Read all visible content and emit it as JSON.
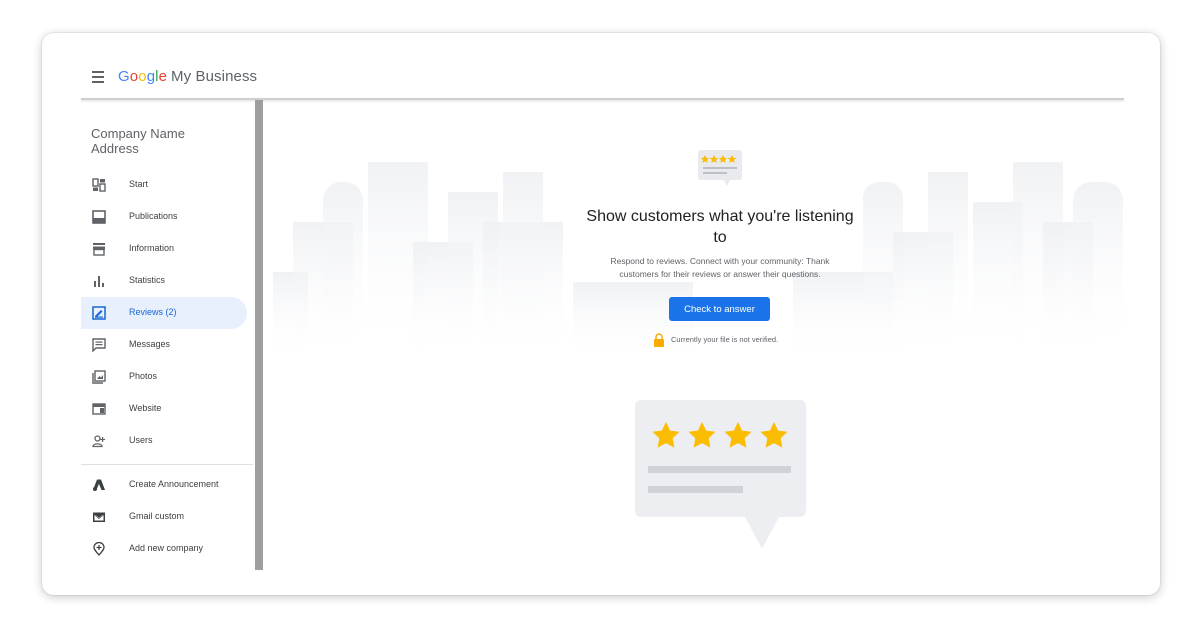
{
  "header": {
    "logo_letters": [
      "G",
      "o",
      "o",
      "g",
      "l",
      "e"
    ],
    "logo_rest": "My Business"
  },
  "sidebar": {
    "company_name": "Company Name",
    "company_address": "Address",
    "items": [
      {
        "label": "Start",
        "icon": "dashboard-icon",
        "active": false
      },
      {
        "label": "Publications",
        "icon": "posts-icon",
        "active": false
      },
      {
        "label": "Information",
        "icon": "store-icon",
        "active": false
      },
      {
        "label": "Statistics",
        "icon": "bar-chart-icon",
        "active": false
      },
      {
        "label": "Reviews (2)",
        "icon": "reviews-icon",
        "active": true
      },
      {
        "label": "Messages",
        "icon": "message-icon",
        "active": false
      },
      {
        "label": "Photos",
        "icon": "photos-icon",
        "active": false
      },
      {
        "label": "Website",
        "icon": "website-icon",
        "active": false
      },
      {
        "label": "Users",
        "icon": "add-user-icon",
        "active": false
      }
    ],
    "secondary_items": [
      {
        "label": "Create Announcement",
        "icon": "google-ads-icon"
      },
      {
        "label": "Gmail custom",
        "icon": "gmail-icon"
      },
      {
        "label": "Add new company",
        "icon": "add-location-icon"
      }
    ]
  },
  "main": {
    "headline": "Show customers what you're listening to",
    "subtext": "Respond to reviews. Connect with your community: Thank customers for their reviews or answer their questions.",
    "cta_label": "Check to answer",
    "verification_text": "Currently your file is not verified.",
    "badge_stars": 4,
    "illustration_stars": 4
  },
  "colors": {
    "accent": "#1a73e8",
    "active_bg": "#e8f0fe",
    "active_text": "#1967d2",
    "star": "#fbbc04",
    "lock": "#f9ab00"
  }
}
